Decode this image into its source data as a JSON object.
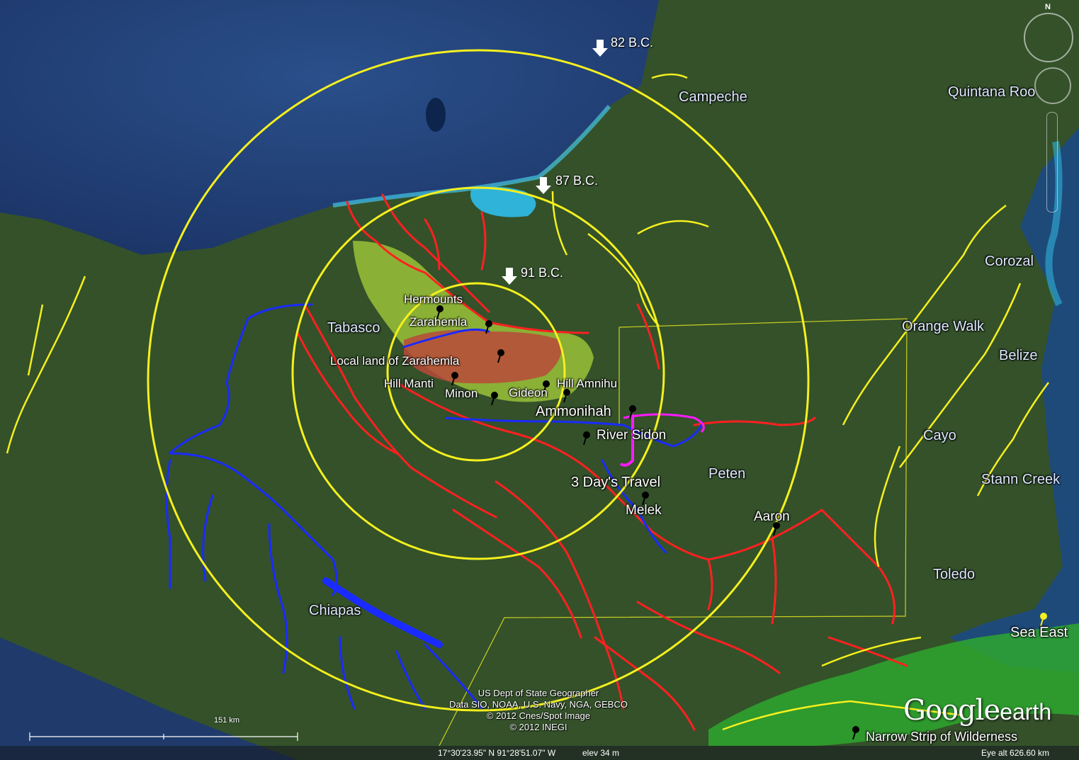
{
  "map": {
    "year_markers": [
      "82 B.C.",
      "87 B.C.",
      "91 B.C."
    ],
    "regions": [
      "Campeche",
      "Quintana Roo",
      "Tabasco",
      "Chiapas",
      "Peten",
      "Corozal",
      "Orange Walk",
      "Belize",
      "Cayo",
      "Stann Creek",
      "Toledo"
    ],
    "places": {
      "hermounts": "Hermounts",
      "zarahemla": "Zarahemla",
      "local_land": "Local land of Zarahemla",
      "hill_manti": "Hill Manti",
      "minon": "Minon",
      "gideon": "Gideon",
      "hill_amnihu": "Hill Amnihu",
      "ammonihah": "Ammonihah",
      "river_sidon": "River Sidon",
      "travel": "3 Day's Travel",
      "melek": "Melek",
      "aaron": "Aaron",
      "sea_east": "Sea East",
      "wilderness": "Narrow Strip of Wilderness"
    },
    "colors": {
      "rings": "#f5f01e",
      "rivers_red": "#ff2020",
      "rivers_blue": "#1a2bff",
      "land_zarahemla": "#a0c83a",
      "local_land": "#b84a3a",
      "travel_route": "#ff1aff",
      "wilderness": "#2ea62e"
    }
  },
  "credits": {
    "line1": "US Dept of State Geographer",
    "line2": "Data SIO, NOAA, U.S. Navy, NGA, GEBCO",
    "line3": "© 2012 Cnes/Spot Image",
    "line4": "© 2012 INEGI"
  },
  "scale": {
    "label": "151 km"
  },
  "status": {
    "coords": "17°30'23.95\" N  91°28'51.07\" W",
    "elev": "elev    34 m",
    "eye_alt": "Eye alt   626.60 km"
  },
  "logo": {
    "google": "Google",
    "earth": "earth"
  },
  "compass": {
    "north": "N"
  }
}
